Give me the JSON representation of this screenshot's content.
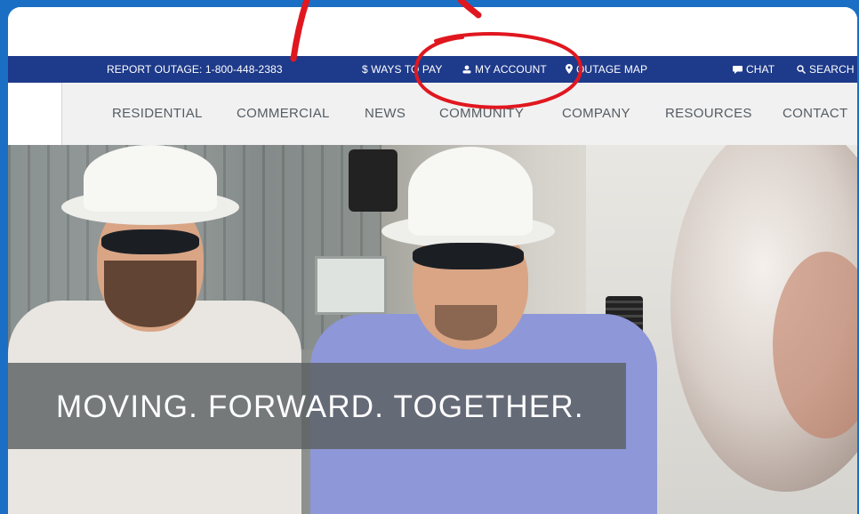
{
  "utility_bar": {
    "report_outage": "REPORT OUTAGE: 1-800-448-2383",
    "ways_to_pay": "$ WAYS TO PAY",
    "my_account": "MY ACCOUNT",
    "outage_map": "OUTAGE MAP",
    "chat": "CHAT",
    "search": "SEARCH"
  },
  "main_nav": {
    "items": [
      {
        "label": "RESIDENTIAL"
      },
      {
        "label": "COMMERCIAL"
      },
      {
        "label": "NEWS"
      },
      {
        "label": "COMMUNITY"
      },
      {
        "label": "COMPANY"
      },
      {
        "label": "RESOURCES"
      },
      {
        "label": "CONTACT"
      }
    ]
  },
  "hero": {
    "tagline": "MOVING. FORWARD. TOGETHER."
  },
  "colors": {
    "frame_blue": "#1a6fc4",
    "utility_bar": "#1e3a8a",
    "annotation_red": "#e0171f"
  },
  "annotation": {
    "type": "hand-drawn red circle highlighting My Account link"
  }
}
